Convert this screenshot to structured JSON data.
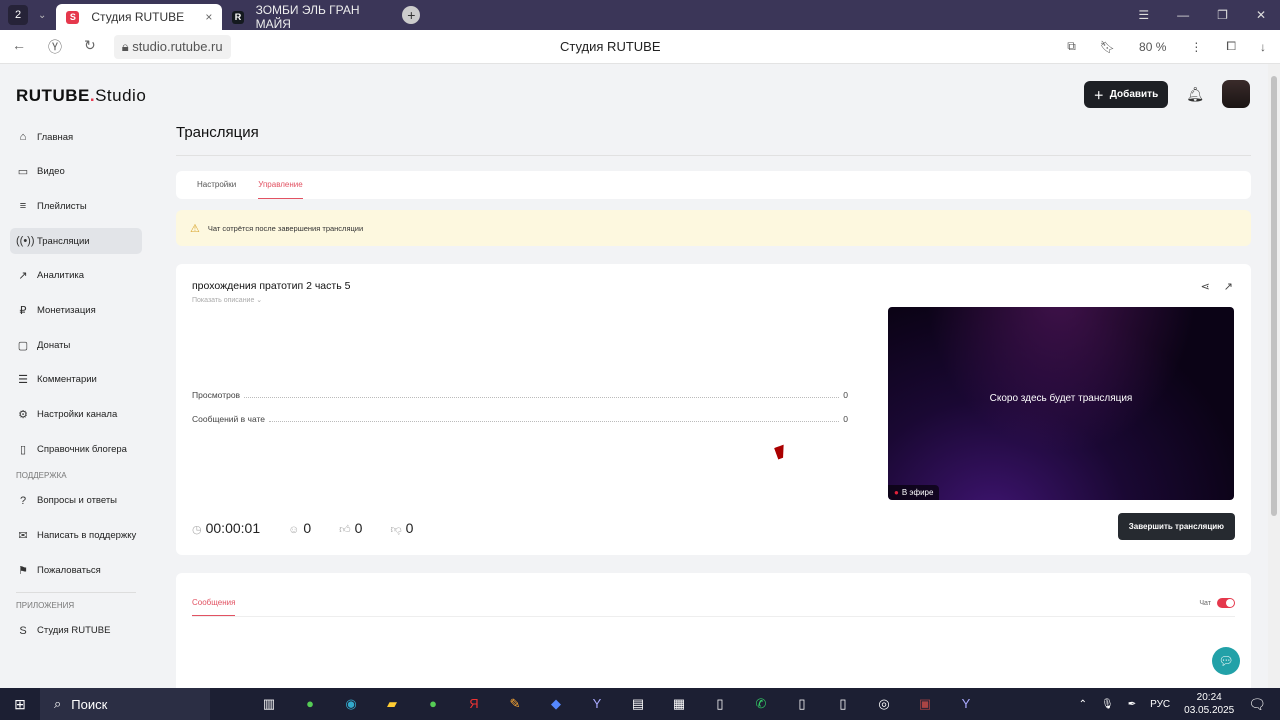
{
  "browser": {
    "tab_count": "2",
    "tabs": [
      {
        "label": "Студия RUTUBE",
        "icon": "S",
        "color": "#e5384c"
      },
      {
        "label": "ЗОМБИ ЭЛЬ ГРАН МАЙЯ",
        "icon": "R",
        "color": "#14191f"
      }
    ],
    "url": "studio.rutube.ru",
    "page_title": "Студия RUTUBE",
    "zoom": "80 %"
  },
  "logo": {
    "brand": "RUTUBE",
    "suffix": "Studio"
  },
  "header": {
    "add_label": "Добавить"
  },
  "sidebar": {
    "items": [
      {
        "label": "Главная",
        "icon": "⌂"
      },
      {
        "label": "Видео",
        "icon": "▭"
      },
      {
        "label": "Плейлисты",
        "icon": "≡"
      },
      {
        "label": "Трансляции",
        "icon": "((•))"
      },
      {
        "label": "Аналитика",
        "icon": "↗"
      },
      {
        "label": "Монетизация",
        "icon": "₽"
      },
      {
        "label": "Донаты",
        "icon": "▢"
      },
      {
        "label": "Комментарии",
        "icon": "☰"
      },
      {
        "label": "Настройки канала",
        "icon": "⚙"
      },
      {
        "label": "Справочник блогера",
        "icon": "▯"
      }
    ],
    "support_title": "ПОДДЕРЖКА",
    "support": [
      {
        "label": "Вопросы и ответы",
        "icon": "?"
      },
      {
        "label": "Написать в поддержку",
        "icon": "✉"
      },
      {
        "label": "Пожаловаться",
        "icon": "⚑"
      }
    ],
    "apps_title": "ПРИЛОЖЕНИЯ",
    "apps": [
      {
        "label": "Студия RUTUBE",
        "icon": "S"
      }
    ]
  },
  "main": {
    "title": "Трансляция",
    "tabs": [
      "Настройки",
      "Управление"
    ],
    "warning": "Чат сотрётся после завершения трансляции",
    "stream": {
      "name": "прохождения пратотип 2 часть 5",
      "show_description": "Показать описание ⌄",
      "stats": [
        {
          "label": "Просмотров",
          "value": "0"
        },
        {
          "label": "Сообщений в чате",
          "value": "0"
        }
      ],
      "duration": "00:00:01",
      "viewers": "0",
      "likes": "0",
      "dislikes": "0",
      "player_text": "Скоро здесь будет трансляция",
      "live_label": "В эфире",
      "end_button": "Завершить трансляцию"
    },
    "messages_tab": "Сообщения",
    "chat_label": "Чат",
    "chat_enabled": true
  },
  "taskbar": {
    "search": "Поиск",
    "lang": "РУС",
    "time": "20:24",
    "date": "03.05.2025"
  }
}
